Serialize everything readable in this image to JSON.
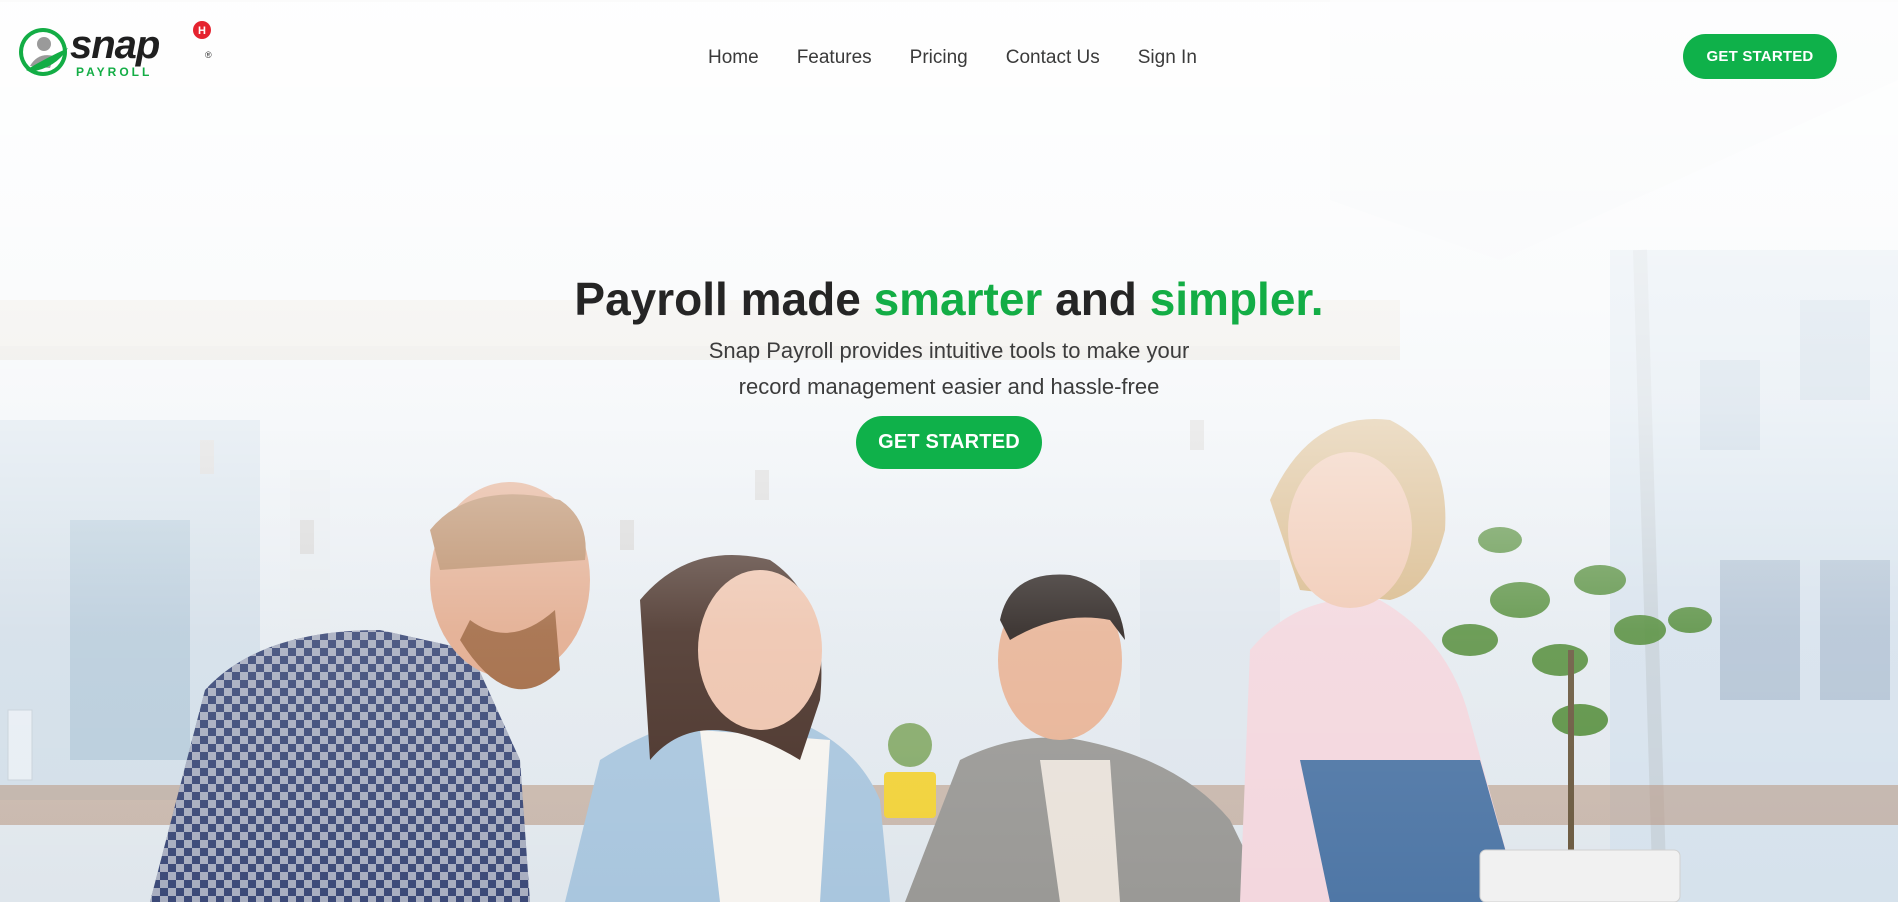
{
  "brand": {
    "logo_text": "snap",
    "logo_subtext": "PAYROLL",
    "logo_badge": "H",
    "registered_mark": "®",
    "colors": {
      "green": "#13ad45",
      "dark": "#222222",
      "badge_red": "#e5232f"
    }
  },
  "nav": {
    "items": [
      {
        "label": "Home"
      },
      {
        "label": "Features"
      },
      {
        "label": "Pricing"
      },
      {
        "label": "Contact Us"
      },
      {
        "label": "Sign In"
      }
    ]
  },
  "header": {
    "cta_label": "GET STARTED"
  },
  "hero": {
    "headline": {
      "part1": "Payroll made ",
      "part2": "smarter",
      "part3": " and ",
      "part4": "simpler."
    },
    "subtitle_line1": "Snap Payroll provides intuitive tools to make your",
    "subtitle_line2": "record management easier and hassle-free",
    "cta_label": "GET STARTED",
    "background_image": "office team photo"
  }
}
